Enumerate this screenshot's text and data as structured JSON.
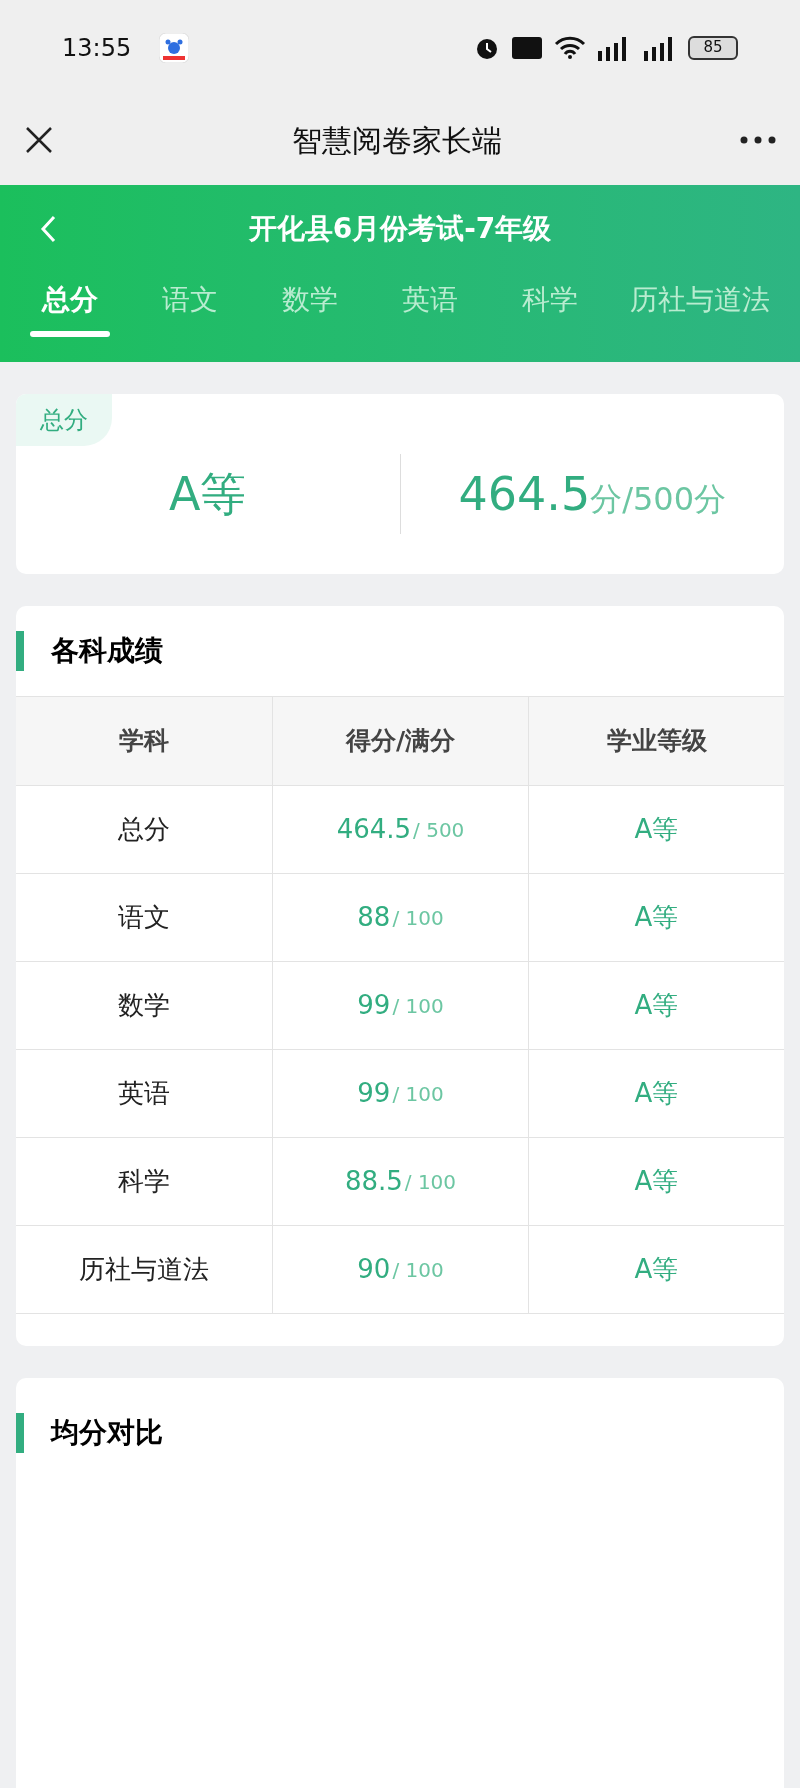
{
  "status_bar": {
    "time": "13:55",
    "battery": "85"
  },
  "nav_bar": {
    "title": "智慧阅卷家长端"
  },
  "header": {
    "title": "开化县6月份考试-7年级"
  },
  "tabs": [
    {
      "label": "总分",
      "selected": true
    },
    {
      "label": "语文",
      "selected": false
    },
    {
      "label": "数学",
      "selected": false
    },
    {
      "label": "英语",
      "selected": false
    },
    {
      "label": "科学",
      "selected": false
    },
    {
      "label": "历社与道法",
      "selected": false
    }
  ],
  "summary_card": {
    "tag": "总分",
    "grade": "A等",
    "score": "464.5",
    "score_unit": "分",
    "full_score": "/500分"
  },
  "scores_section": {
    "title": "各科成绩",
    "columns": [
      "学科",
      "得分/满分",
      "学业等级"
    ],
    "rows": [
      {
        "subject": "总分",
        "score": "464.5",
        "full": "/ 500",
        "grade": "A等"
      },
      {
        "subject": "语文",
        "score": "88",
        "full": "/ 100",
        "grade": "A等"
      },
      {
        "subject": "数学",
        "score": "99",
        "full": "/ 100",
        "grade": "A等"
      },
      {
        "subject": "英语",
        "score": "99",
        "full": "/ 100",
        "grade": "A等"
      },
      {
        "subject": "科学",
        "score": "88.5",
        "full": "/ 100",
        "grade": "A等"
      },
      {
        "subject": "历社与道法",
        "score": "90",
        "full": "/ 100",
        "grade": "A等"
      }
    ]
  },
  "average_section": {
    "title": "均分对比"
  }
}
